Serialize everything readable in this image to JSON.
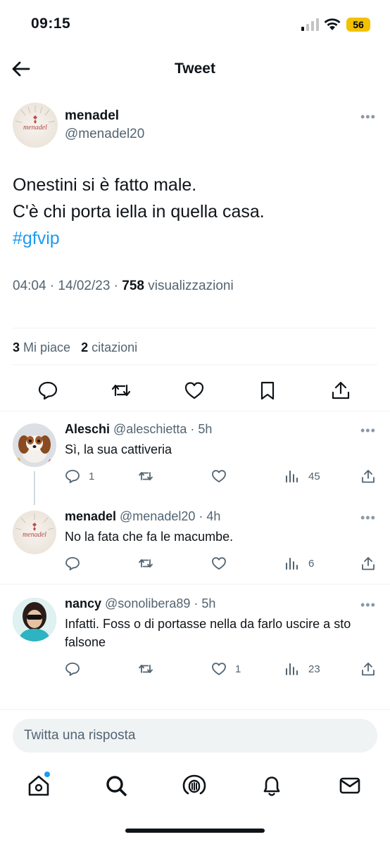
{
  "status_bar": {
    "time": "09:15",
    "battery": "56",
    "icons": [
      "signal-icon",
      "wifi-icon",
      "battery-icon"
    ]
  },
  "header": {
    "title": "Tweet",
    "back_icon": "arrow-left-icon"
  },
  "tweet": {
    "author_name": "menadel",
    "author_handle": "@menadel20",
    "avatar_text": "menadel",
    "text_line1": "Onestini si è fatto male.",
    "text_line2": "C'è chi porta iella in quella casa.",
    "hashtag": "#gfvip",
    "timestamp": "04:04 · 14/02/23 · ",
    "views_count": "758",
    "views_label": " visualizzazioni",
    "likes_count": "3",
    "likes_label": " Mi piace",
    "quotes_count": "2",
    "quotes_label": " citazioni",
    "actions": [
      "reply-icon",
      "retweet-icon",
      "like-icon",
      "bookmark-icon",
      "share-icon"
    ]
  },
  "replies": [
    {
      "name": "Aleschi",
      "handle": " @aleschietta · 5h",
      "text": "Sì, la sua cattiveria",
      "reply_count": "1",
      "retweet_count": "",
      "like_count": "",
      "views_count": "45"
    },
    {
      "name": "menadel",
      "handle": " @menadel20 · 4h",
      "text": "No la fata che fa le macumbe.",
      "avatar_text": "menadel",
      "reply_count": "",
      "retweet_count": "",
      "like_count": "",
      "views_count": "6"
    },
    {
      "name": "nancy",
      "handle": " @sonolibera89 · 5h",
      "text": "Infatti. Foss o di portasse nella da farlo uscire a sto  falsone",
      "reply_count": "",
      "retweet_count": "",
      "like_count": "1",
      "views_count": "23"
    }
  ],
  "composer": {
    "placeholder": "Twitta una risposta"
  },
  "bottom_nav": [
    "home-icon",
    "search-icon",
    "spaces-icon",
    "notifications-icon",
    "messages-icon"
  ],
  "colors": {
    "accent": "#1d9bf0",
    "text_primary": "#0f1419",
    "text_secondary": "#536471",
    "divider": "#eff3f4",
    "battery": "#f2c200"
  }
}
